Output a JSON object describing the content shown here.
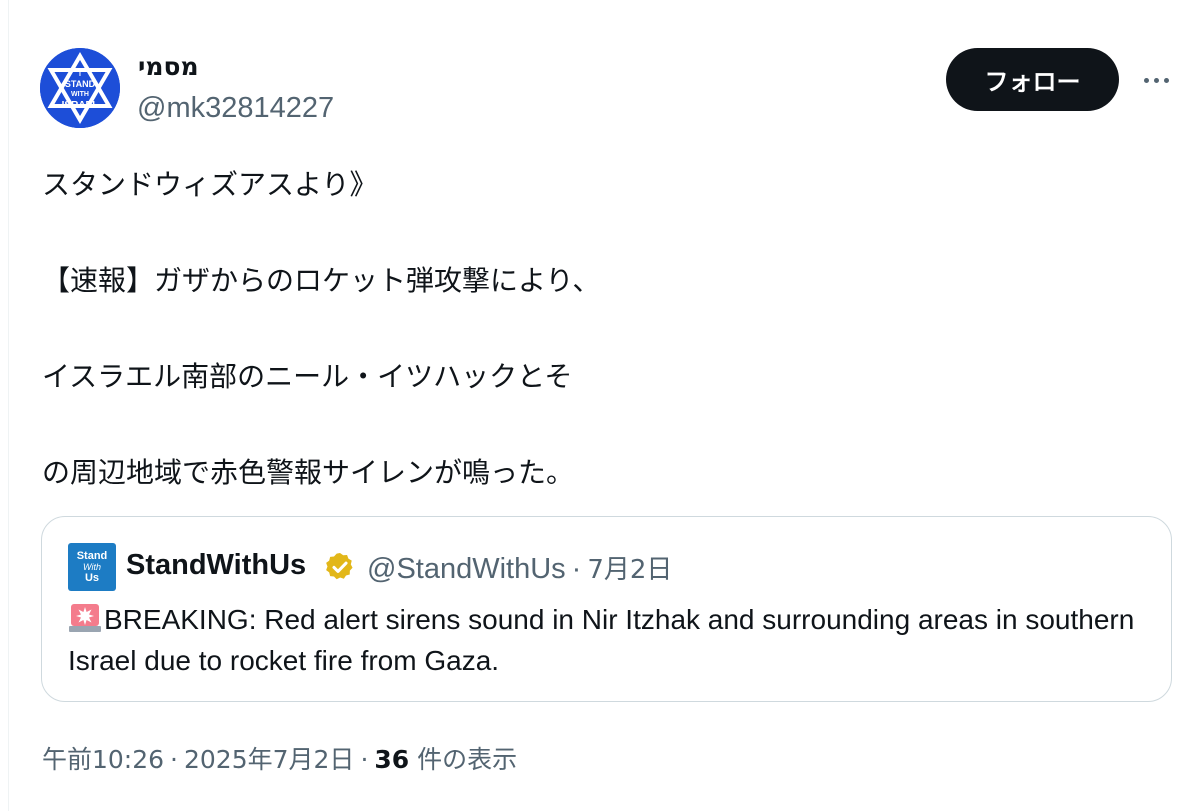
{
  "author": {
    "display_name": "מסמי",
    "handle": "@mk32814227",
    "avatar_text": [
      "I",
      "STAND",
      "WITH",
      "ISRAEL"
    ],
    "avatar_color": "#1d4ed8"
  },
  "actions": {
    "follow_label": "フォロー",
    "more_icon": "ellipsis-icon"
  },
  "tweet": {
    "lines": [
      "スタンドウィズアスより》",
      "【速報】ガザからのロケット弾攻撃により、",
      "イスラエル南部のニール・イツハックとそ",
      "の周辺地域で赤色警報サイレンが鳴った。"
    ]
  },
  "quote": {
    "avatar_lines": [
      "Stand",
      "With",
      "Us"
    ],
    "name": "StandWithUs",
    "verified_icon": "verified-badge-icon",
    "verified_color": "#e2b719",
    "handle": "@StandWithUs",
    "separator": "·",
    "date": "7月2日",
    "siren_icon": "rotating-light-icon",
    "text": "BREAKING: Red alert sirens sound in Nir Itzhak and surrounding areas in southern Israel due to rocket fire from Gaza."
  },
  "footer": {
    "time": "午前10:26",
    "separator": "·",
    "date": "2025年7月2日",
    "views_count": "36",
    "views_label": "件の表示"
  }
}
